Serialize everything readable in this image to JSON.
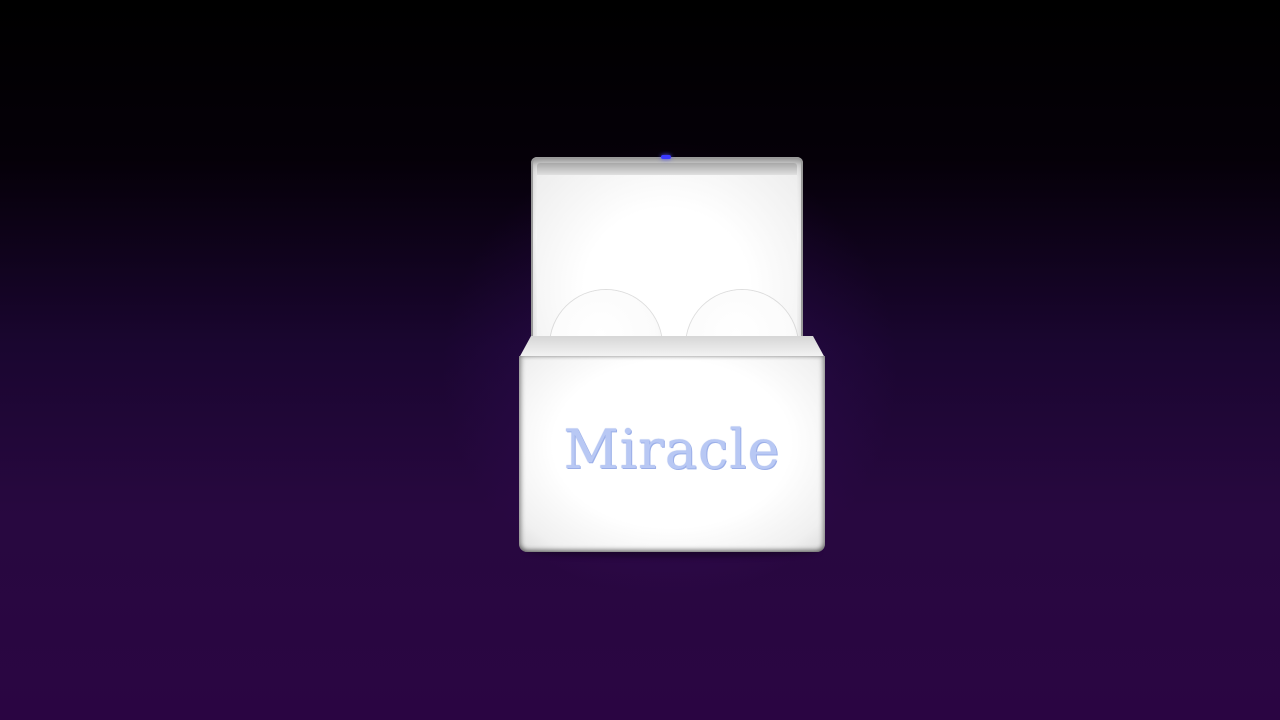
{
  "scene": {
    "brand_text": "Miracle",
    "colors": {
      "background_top": "#000000",
      "background_bottom": "#2a0542",
      "box": "#ffffff",
      "brand_text": "#b8c8f4",
      "eye_light": "#6a66ff",
      "clasp": "#3a3aff"
    },
    "icons": {
      "box": "gift-box-icon",
      "character": "round-head-icon"
    }
  }
}
